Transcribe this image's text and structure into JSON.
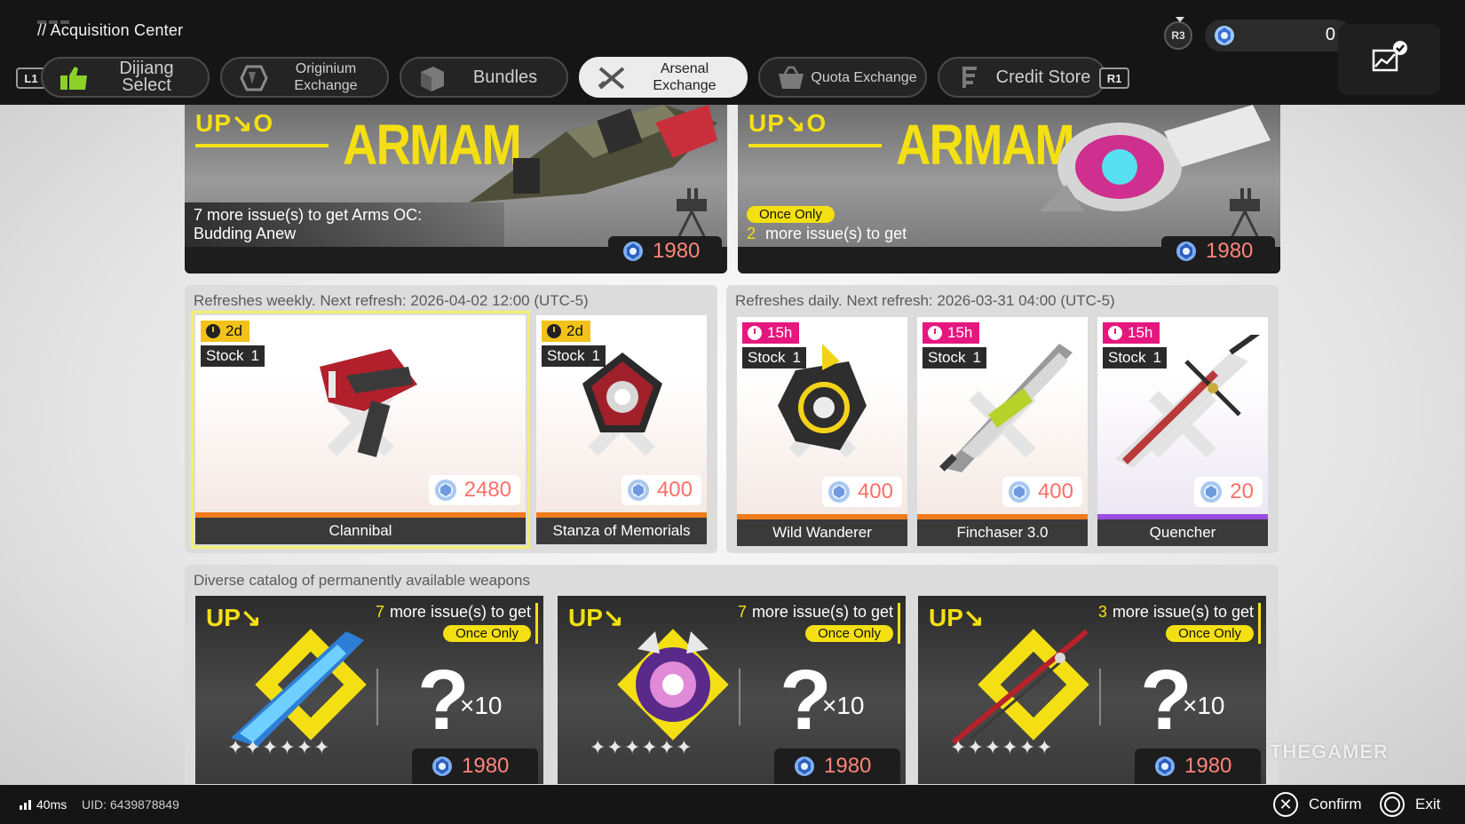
{
  "header": {
    "title": "// Acquisition Center",
    "r3_label": "R3",
    "currency_value": "0"
  },
  "tabs": {
    "left_bumper": "L1",
    "right_bumper": "R1",
    "items": [
      {
        "label": "Dijiang Select",
        "icon": "hand-icon"
      },
      {
        "label": "Originium Exchange",
        "icon": "crystal-icon"
      },
      {
        "label": "Bundles",
        "icon": "box-icon"
      },
      {
        "label": "Arsenal Exchange",
        "icon": "crossed-swords-icon"
      },
      {
        "label": "Quota Exchange",
        "icon": "basket-icon"
      },
      {
        "label": "Credit Store",
        "icon": "credit-icon"
      }
    ],
    "active_index": 3
  },
  "banners": [
    {
      "up": "UP↘O",
      "title_art": "ARMAM",
      "desc_line1": "7 more issue(s) to get Arms OC:",
      "desc_line2": "Budding Anew",
      "price": "1980"
    },
    {
      "up": "UP↘O",
      "title_art": "ARMAM",
      "once_badge": "Once Only",
      "issues_num": "2",
      "issues_text": "more issue(s) to get",
      "price": "1980"
    }
  ],
  "weekly": {
    "title": "Refreshes weekly. Next refresh: 2026-04-02 12:00 (UTC-5)",
    "items": [
      {
        "timer": "2d",
        "stock_label": "Stock",
        "stock": "1",
        "price": "2480",
        "name": "Clannibal"
      },
      {
        "timer": "2d",
        "stock_label": "Stock",
        "stock": "1",
        "price": "400",
        "name": "Stanza of Memorials"
      }
    ]
  },
  "daily": {
    "title": "Refreshes daily. Next refresh: 2026-03-31 04:00 (UTC-5)",
    "items": [
      {
        "timer": "15h",
        "stock_label": "Stock",
        "stock": "1",
        "price": "400",
        "name": "Wild Wanderer"
      },
      {
        "timer": "15h",
        "stock_label": "Stock",
        "stock": "1",
        "price": "400",
        "name": "Finchaser 3.0"
      },
      {
        "timer": "15h",
        "stock_label": "Stock",
        "stock": "1",
        "price": "20",
        "name": "Quencher"
      }
    ]
  },
  "permanent": {
    "title": "Diverse catalog of permanently available weapons",
    "items": [
      {
        "up": "UP↘",
        "issues_num": "7",
        "issues_text": "more issue(s) to get",
        "once": "Once Only",
        "qmark": "?",
        "mult": "×10",
        "stars": "✦✦✦✦✦✦",
        "price": "1980"
      },
      {
        "up": "UP↘",
        "issues_num": "7",
        "issues_text": "more issue(s) to get",
        "once": "Once Only",
        "qmark": "?",
        "mult": "×10",
        "stars": "✦✦✦✦✦✦",
        "price": "1980"
      },
      {
        "up": "UP↘",
        "issues_num": "3",
        "issues_text": "more issue(s) to get",
        "once": "Once Only",
        "qmark": "?",
        "mult": "×10",
        "stars": "✦✦✦✦✦✦",
        "price": "1980"
      }
    ]
  },
  "footer": {
    "ping": "40ms",
    "uid_label": "UID:",
    "uid": "6439878849",
    "confirm": "Confirm",
    "exit": "Exit"
  },
  "watermark": "THEGAMER",
  "colors": {
    "accent_yellow": "#f4e012",
    "price_red": "#ff6f66",
    "timer_yellow": "#f2c21a",
    "timer_pink": "#e5177f",
    "rarity_orange": "#f07b1a",
    "rarity_purple": "#9a4de0"
  }
}
